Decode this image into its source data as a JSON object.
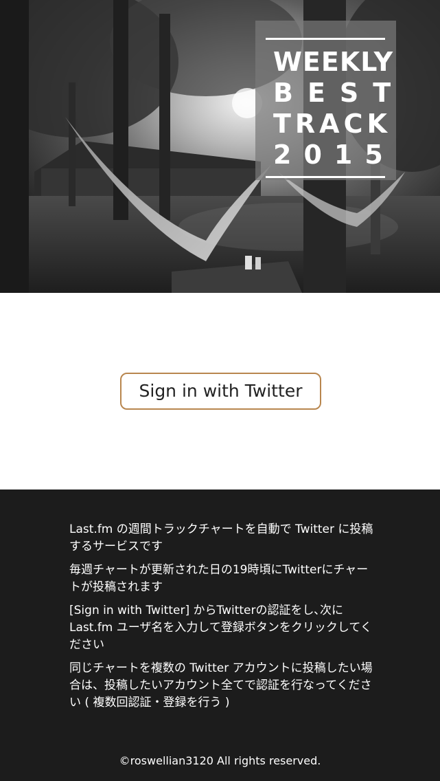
{
  "hero": {
    "title_lines": [
      "WEEKLY",
      "BEST",
      "TRACK",
      "2015"
    ]
  },
  "signin": {
    "label": "Sign in with Twitter"
  },
  "description": {
    "paragraphs": [
      "Last.fm の週間トラックチャートを自動で Twitter に投稿するサービスです",
      "毎週チャートが更新された日の19時頃にTwitterにチャートが投稿されます",
      "[Sign in with Twitter] からTwitterの認証をし､次にLast.fm ユーザ名を入力して登録ボタンをクリックしてください",
      "同じチャートを複数の Twitter アカウントに投稿したい場合は、投稿したいアカウント全てで認証を行なってください ( 複数回認証・登録を行う )"
    ]
  },
  "footer": {
    "copyright": "©roswellian3120 All rights reserved."
  }
}
